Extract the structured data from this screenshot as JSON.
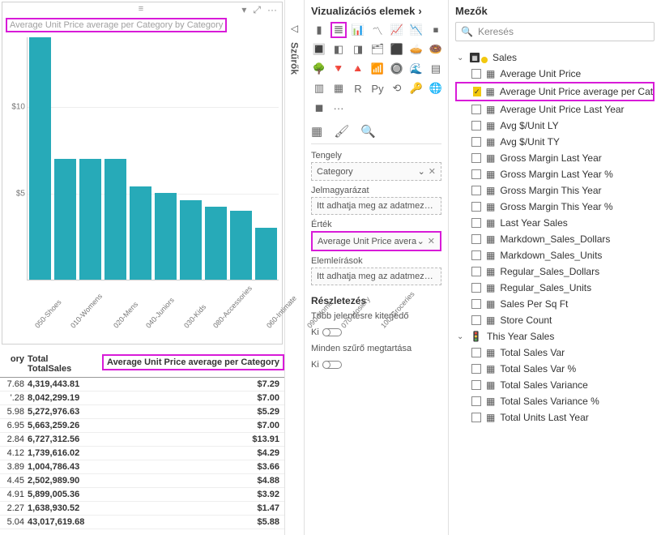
{
  "chart": {
    "title": "Average Unit Price average per Category by Category",
    "toolbar": {
      "filter": "▾",
      "focus": "⤢",
      "more": "···",
      "grip": "≡"
    }
  },
  "chart_data": {
    "type": "bar",
    "title": "Average Unit Price average per Category by Category",
    "xlabel": "",
    "ylabel": "",
    "ylim": [
      0,
      14
    ],
    "yticks": [
      5,
      10
    ],
    "ytick_labels": [
      "$5",
      "$10"
    ],
    "categories": [
      "050-Shoes",
      "010-Womens",
      "020-Mens",
      "040-Juniors",
      "030-Kids",
      "080-Accessories",
      "060-Intimate",
      "090-Home",
      "070-Hosiery",
      "100-Groceries"
    ],
    "values": [
      14,
      7,
      7,
      7,
      5.4,
      5.0,
      4.6,
      4.2,
      4.0,
      3.0
    ]
  },
  "table": {
    "headers": {
      "c1": "ory",
      "c2_top": "Total",
      "c2": "TotalSales",
      "c3": "Average Unit Price average per Category"
    },
    "rows": [
      {
        "c1": "7.68",
        "c2": "4,319,443.81",
        "c3": "$7.29"
      },
      {
        "c1": "'.28",
        "c2": "8,042,299.19",
        "c3": "$7.00"
      },
      {
        "c1": "5.98",
        "c2": "5,272,976.63",
        "c3": "$5.29"
      },
      {
        "c1": "6.95",
        "c2": "5,663,259.26",
        "c3": "$7.00"
      },
      {
        "c1": "2.84",
        "c2": "6,727,312.56",
        "c3": "$13.91"
      },
      {
        "c1": "4.12",
        "c2": "1,739,616.02",
        "c3": "$4.29"
      },
      {
        "c1": "3.89",
        "c2": "1,004,786.43",
        "c3": "$3.66"
      },
      {
        "c1": "4.45",
        "c2": "2,502,989.90",
        "c3": "$4.88"
      },
      {
        "c1": "4.91",
        "c2": "5,899,005.36",
        "c3": "$3.92"
      },
      {
        "c1": "2.27",
        "c2": "1,638,930.52",
        "c3": "$1.47"
      },
      {
        "c1": "5.04",
        "c2": "43,017,619.68",
        "c3": "$5.88"
      }
    ]
  },
  "filters": {
    "title": "Szűrők"
  },
  "viz": {
    "title": "Vizualizációs elemek",
    "tabs": {
      "fields": "▦",
      "format": "🖌",
      "analytics": "🔍"
    },
    "wells": {
      "axis": {
        "label": "Tengely",
        "value": "Category"
      },
      "legend": {
        "label": "Jelmagyarázat",
        "placeholder": "Itt adhatja meg az adatmez…"
      },
      "values": {
        "label": "Érték",
        "value": "Average Unit Price avera"
      },
      "tooltips": {
        "label": "Elemleírások",
        "placeholder": "Itt adhatja meg az adatmez…"
      }
    },
    "drill": {
      "title": "Részletezés",
      "cross": "Több jelentésre kiterjedő",
      "keep": "Minden szűrő megtartása",
      "off": "Ki"
    }
  },
  "fields": {
    "title": "Mezők",
    "search_placeholder": "Keresés",
    "tables": [
      {
        "name": "Sales",
        "expanded": true,
        "badge": true,
        "columns": [
          {
            "name": "Average Unit Price",
            "checked": false,
            "icon": "▦"
          },
          {
            "name": "Average Unit Price average per Cate…",
            "checked": true,
            "icon": "▦",
            "highlight": true
          },
          {
            "name": "Average Unit Price Last Year",
            "checked": false,
            "icon": "▦"
          },
          {
            "name": "Avg $/Unit LY",
            "checked": false,
            "icon": "▦"
          },
          {
            "name": "Avg $/Unit TY",
            "checked": false,
            "icon": "▦"
          },
          {
            "name": "Gross Margin Last Year",
            "checked": false,
            "icon": "▦"
          },
          {
            "name": "Gross Margin Last Year %",
            "checked": false,
            "icon": "▦"
          },
          {
            "name": "Gross Margin This Year",
            "checked": false,
            "icon": "▦"
          },
          {
            "name": "Gross Margin This Year %",
            "checked": false,
            "icon": "▦"
          },
          {
            "name": "Last Year Sales",
            "checked": false,
            "icon": "▦"
          },
          {
            "name": "Markdown_Sales_Dollars",
            "checked": false,
            "icon": "▦"
          },
          {
            "name": "Markdown_Sales_Units",
            "checked": false,
            "icon": "▦"
          },
          {
            "name": "Regular_Sales_Dollars",
            "checked": false,
            "icon": "▦"
          },
          {
            "name": "Regular_Sales_Units",
            "checked": false,
            "icon": "▦"
          },
          {
            "name": "Sales Per Sq Ft",
            "checked": false,
            "icon": "▦"
          },
          {
            "name": "Store Count",
            "checked": false,
            "icon": "▦"
          }
        ]
      },
      {
        "name": "This Year Sales",
        "expanded": true,
        "badge": false,
        "kpi": true,
        "columns": [
          {
            "name": "Total Sales Var",
            "checked": false,
            "icon": "▦"
          },
          {
            "name": "Total Sales Var %",
            "checked": false,
            "icon": "▦"
          },
          {
            "name": "Total Sales Variance",
            "checked": false,
            "icon": "▦"
          },
          {
            "name": "Total Sales Variance %",
            "checked": false,
            "icon": "▦"
          },
          {
            "name": "Total Units Last Year",
            "checked": false,
            "icon": "▦"
          }
        ]
      }
    ]
  }
}
